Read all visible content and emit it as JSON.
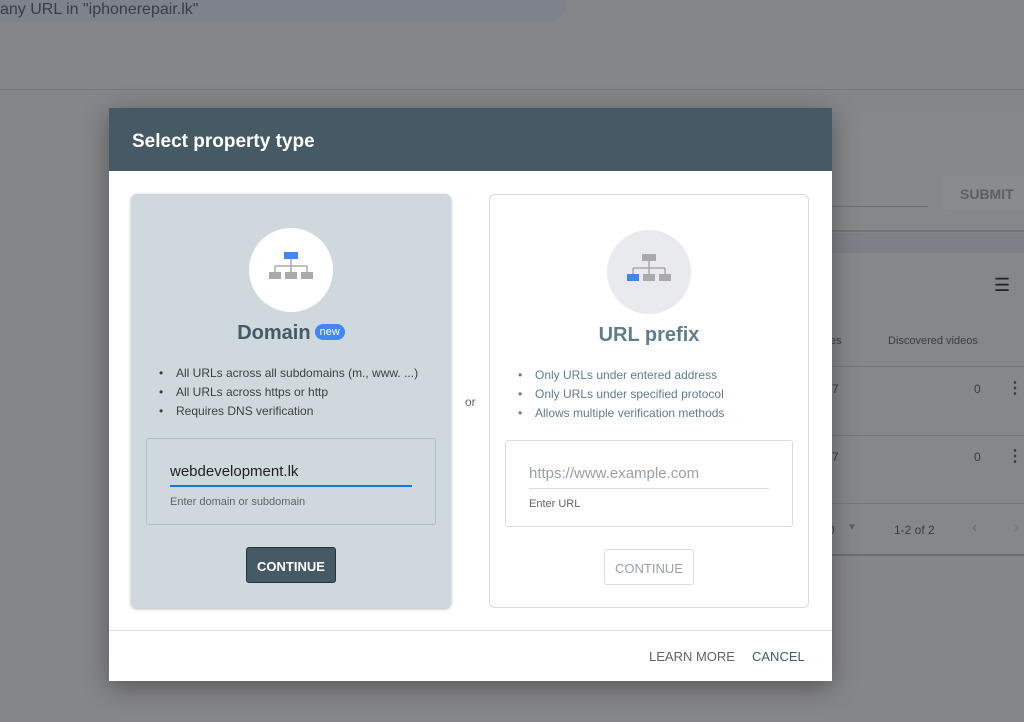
{
  "background": {
    "search_text": "any URL in \"iphonerepair.lk\"",
    "submit_label": "SUBMIT",
    "table_header_partial": "es",
    "table_header": "Discovered videos",
    "rows": [
      {
        "partial": "7",
        "videos": "0"
      },
      {
        "partial": "7",
        "videos": "0"
      }
    ],
    "rows_per_page_partial": "0",
    "pagination": "1-2 of 2"
  },
  "dialog": {
    "title": "Select property type",
    "or_label": "or",
    "domain": {
      "title": "Domain",
      "badge": "new",
      "bullets": [
        "All URLs across all subdomains (m., www. ...)",
        "All URLs across https or http",
        "Requires DNS verification"
      ],
      "input_value": "webdevelopment.lk",
      "input_help": "Enter domain or subdomain",
      "continue_label": "CONTINUE"
    },
    "url_prefix": {
      "title": "URL prefix",
      "bullets": [
        "Only URLs under entered address",
        "Only URLs under specified protocol",
        "Allows multiple verification methods"
      ],
      "input_placeholder": "https://www.example.com",
      "input_help": "Enter URL",
      "continue_label": "CONTINUE"
    },
    "learn_more_label": "LEARN MORE",
    "cancel_label": "CANCEL"
  },
  "colors": {
    "header": "#455a64",
    "accent": "#4285f4",
    "selected_card": "#cfd8dc"
  }
}
